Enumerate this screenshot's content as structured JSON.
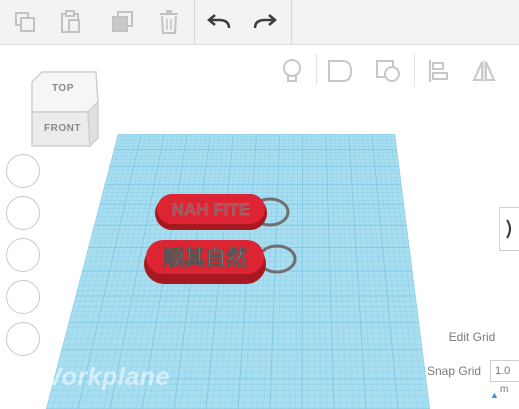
{
  "toolbar": {
    "buttons": [
      "copy-icon",
      "paste-icon",
      "duplicate-icon",
      "delete-icon",
      "undo-icon",
      "redo-icon"
    ]
  },
  "tools": [
    "light-bulb-icon",
    "shape-icon",
    "hole-icon",
    "align-icon",
    "mirror-icon"
  ],
  "viewcube": {
    "top_label": "TOP",
    "front_label": "FRONT"
  },
  "workplane": {
    "label": "Workplane",
    "grid_color": "#7fc8e4",
    "plane_color": "#a9def0"
  },
  "objects": {
    "keychain_top_text": "NAH FITE",
    "keychain_bottom_text": "顺其自然",
    "keychain_color": "#d9222e"
  },
  "grid_controls": {
    "edit_grid_label": "Edit Grid",
    "snap_grid_label": "Snap Grid",
    "snap_grid_value": "1.0",
    "snap_grid_unit": "m"
  }
}
